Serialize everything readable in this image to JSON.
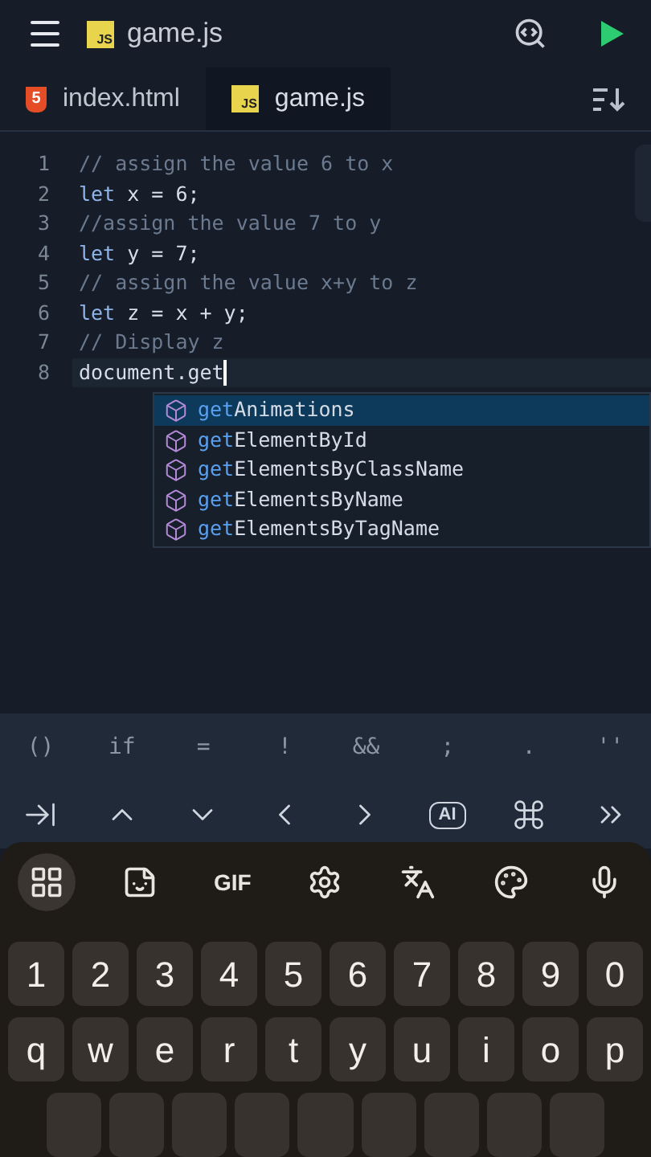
{
  "header": {
    "file_badge": "JS",
    "title": "game.js"
  },
  "tabs": [
    {
      "kind": "html",
      "badge": "5",
      "label": "index.html",
      "selected": false
    },
    {
      "kind": "js",
      "badge": "JS",
      "label": "game.js",
      "selected": true
    }
  ],
  "editor": {
    "lines": [
      {
        "number": "1",
        "current": false,
        "tokens": [
          {
            "kind": "comment",
            "text": "// assign the value 6 to x"
          }
        ]
      },
      {
        "number": "2",
        "current": false,
        "tokens": [
          {
            "kind": "keyword",
            "text": "let"
          },
          {
            "kind": "plain",
            "text": " x = 6;"
          }
        ]
      },
      {
        "number": "3",
        "current": false,
        "tokens": [
          {
            "kind": "comment",
            "text": "//assign the value 7 to y"
          }
        ]
      },
      {
        "number": "4",
        "current": false,
        "tokens": [
          {
            "kind": "keyword",
            "text": "let"
          },
          {
            "kind": "plain",
            "text": " y = 7;"
          }
        ]
      },
      {
        "number": "5",
        "current": false,
        "tokens": [
          {
            "kind": "comment",
            "text": "// assign the value x+y to z"
          }
        ]
      },
      {
        "number": "6",
        "current": false,
        "tokens": [
          {
            "kind": "keyword",
            "text": "let"
          },
          {
            "kind": "plain",
            "text": " z = x + y;"
          }
        ]
      },
      {
        "number": "7",
        "current": false,
        "tokens": [
          {
            "kind": "comment",
            "text": "// Display z"
          }
        ]
      },
      {
        "number": "8",
        "current": true,
        "tokens": [
          {
            "kind": "plain",
            "text": "document.get"
          }
        ]
      }
    ]
  },
  "autocomplete": [
    {
      "match": "get",
      "rest": "Animations",
      "selected": true
    },
    {
      "match": "get",
      "rest": "ElementById",
      "selected": false
    },
    {
      "match": "get",
      "rest": "ElementsByClassName",
      "selected": false
    },
    {
      "match": "get",
      "rest": "ElementsByName",
      "selected": false
    },
    {
      "match": "get",
      "rest": "ElementsByTagName",
      "selected": false
    }
  ],
  "symbol_bar": [
    "()",
    "if",
    "=",
    "!",
    "&&",
    ";",
    ".",
    "''"
  ],
  "key_bar": [
    {
      "kind": "tab"
    },
    {
      "kind": "up"
    },
    {
      "kind": "down"
    },
    {
      "kind": "left"
    },
    {
      "kind": "right"
    },
    {
      "kind": "ai",
      "label": "AI"
    },
    {
      "kind": "command"
    },
    {
      "kind": "more"
    }
  ],
  "keyboard": {
    "toolbar": [
      {
        "kind": "apps",
        "selected": true
      },
      {
        "kind": "sticker",
        "selected": false
      },
      {
        "kind": "gif",
        "label": "GIF",
        "selected": false
      },
      {
        "kind": "settings",
        "selected": false
      },
      {
        "kind": "translate",
        "selected": false
      },
      {
        "kind": "palette",
        "selected": false
      },
      {
        "kind": "mic",
        "selected": false
      }
    ],
    "rows": [
      [
        "1",
        "2",
        "3",
        "4",
        "5",
        "6",
        "7",
        "8",
        "9",
        "0"
      ],
      [
        "q",
        "w",
        "e",
        "r",
        "t",
        "y",
        "u",
        "i",
        "o",
        "p"
      ]
    ]
  }
}
